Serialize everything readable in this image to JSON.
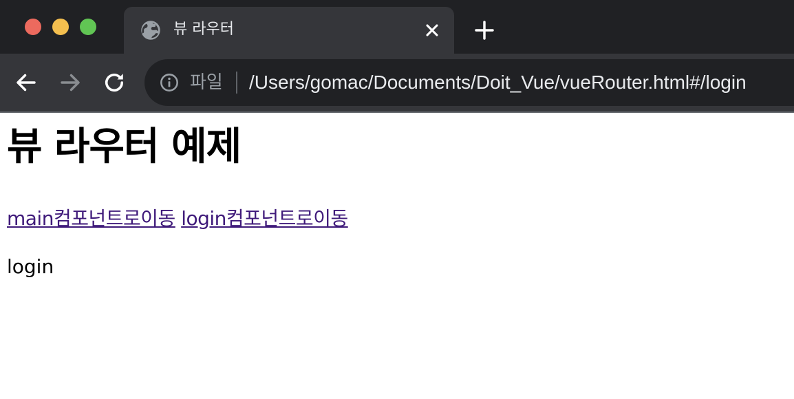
{
  "browser": {
    "tab": {
      "title": "뷰 라우터"
    },
    "omnibox": {
      "scheme_label": "파일",
      "url": "/Users/gomac/Documents/Doit_Vue/vueRouter.html#/login"
    },
    "icons": {
      "tab_favicon": "globe-icon",
      "tab_close": "close-icon",
      "new_tab": "plus-icon",
      "back": "arrow-left-icon",
      "forward": "arrow-right-icon",
      "reload": "reload-icon",
      "site_info": "info-icon"
    },
    "colors": {
      "tabstrip_bg": "#202124",
      "toolbar_bg": "#35363a",
      "link": "#3f1a7a"
    }
  },
  "page": {
    "heading": "뷰 라우터 예제",
    "links": [
      {
        "label": "main컴포넌트로이동"
      },
      {
        "label": "login컴포넌트로이동"
      }
    ],
    "router_view_text": "login"
  }
}
